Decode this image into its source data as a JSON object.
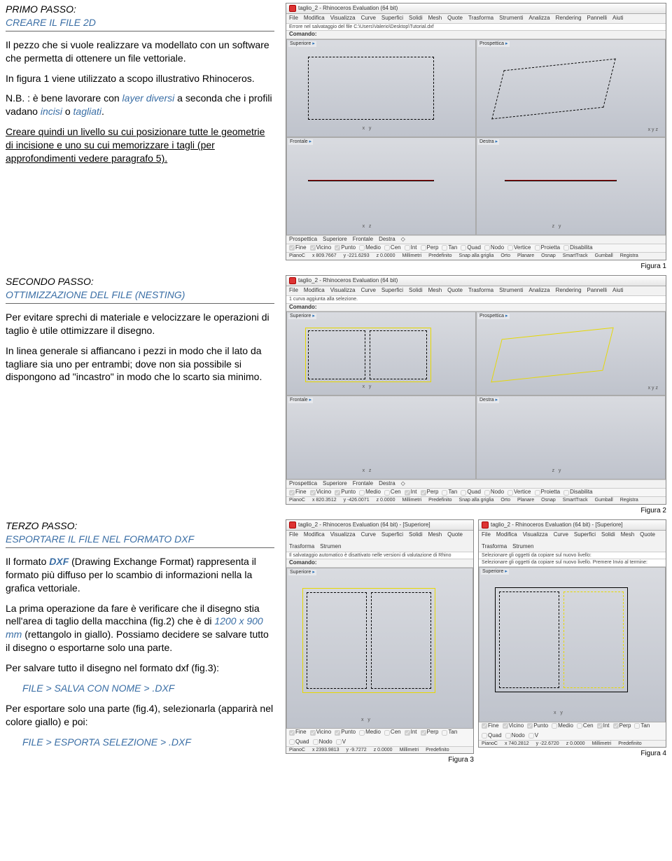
{
  "step1": {
    "label": "PRIMO PASSO:",
    "subtitle": "CREARE IL FILE 2D",
    "p1a": "Il pezzo che si vuole realizzare va modellato con un software che permetta di ottenere un file vettoriale.",
    "p1b": "In figura 1 viene utilizzato a scopo illustrativo Rhinoceros.",
    "p2a": "N.B. : è bene lavorare con ",
    "p2b": "layer diversi",
    "p2c": " a seconda che i profili vadano ",
    "p2d": "incisi",
    "p2e": " o ",
    "p2f": "tagliati",
    "p2g": ".",
    "p3": "Creare quindi un livello su cui posizionare tutte le geometrie di incisione e uno su cui memorizzare i tagli (per approfondimenti vedere paragrafo 5).",
    "figcap": "Figura 1"
  },
  "step2": {
    "label": "SECONDO PASSO:",
    "subtitle": "OTTIMIZZAZIONE DEL FILE (NESTING)",
    "p1": "Per evitare sprechi di materiale e velocizzare le operazioni di taglio è utile ottimizzare il disegno.",
    "p2": "In linea generale si affiancano i pezzi in modo che il lato da tagliare sia uno per entrambi; dove non sia possibile si dispongono ad \"incastro\" in modo che lo scarto sia minimo.",
    "figcap": "Figura 2"
  },
  "step3": {
    "label": "TERZO PASSO:",
    "subtitle": "ESPORTARE IL FILE NEL FORMATO DXF",
    "p1a": "Il formato ",
    "p1b": "DXF",
    "p1c": " (Drawing Exchange Format) rappresenta il formato più diffuso per lo scambio di informazioni nella la grafica vettoriale.",
    "p2a": "La prima operazione da fare è verificare che il disegno stia nell'area di taglio della macchina (fig.2) che è di ",
    "p2b": "1200 x 900 mm",
    "p2c": " (rettangolo in giallo). Possiamo decidere se salvare tutto il disegno o esportarne solo una parte.",
    "p3": "Per salvare tutto il disegno nel formato dxf (fig.3):",
    "menu1": "FILE > SALVA CON NOME > .DXF",
    "p4": "Per esportare solo una parte (fig.4), selezionarla (apparirà nel colore giallo) e poi:",
    "menu2": "FILE > ESPORTA SELEZIONE > .DXF",
    "figcap3": "Figura 3",
    "figcap4": "Figura 4"
  },
  "rhino": {
    "title1": "taglio_2 - Rhinoceros Evaluation (64 bit)",
    "title3": "taglio_2 - Rhinoceros Evaluation (64 bit) - [Superiore]",
    "menus": [
      "File",
      "Modifica",
      "Visualizza",
      "Curve",
      "Superfici",
      "Solidi",
      "Mesh",
      "Quote",
      "Trasforma",
      "Strumenti",
      "Analizza",
      "Rendering",
      "Pannelli",
      "Aiuti"
    ],
    "menus_short": [
      "File",
      "Modifica",
      "Visualizza",
      "Curve",
      "Superfici",
      "Solidi",
      "Mesh",
      "Quote",
      "Trasforma",
      "Strumen"
    ],
    "cmd1_1": "Errore nel salvataggio del file C:\\Users\\Valerio\\Desktop\\Tutorial.dxf",
    "cmd_label": "Comando:",
    "cmd2_1": "1 curva aggiunta alla selezione.",
    "cmd3_1": "Il salvataggio automatico è disattivato nelle versioni di valutazione di Rhino",
    "cmd4_1": "Selezionare gli oggetti da copiare sul nuovo livello:",
    "cmd4_2": "Selezionare gli oggetti da copiare sul nuovo livello. Premere Invio al termine:",
    "views": {
      "sup": "Superiore",
      "pro": "Prospettica",
      "fro": "Frontale",
      "des": "Destra"
    },
    "tabs": [
      "Prospettica",
      "Superiore",
      "Frontale",
      "Destra",
      "◇"
    ],
    "osnap": [
      "Fine",
      "Vicino",
      "Punto",
      "Medio",
      "Cen",
      "Int",
      "Perp",
      "Tan",
      "Quad",
      "Nodo",
      "Vertice",
      "Proietta",
      "Disabilita"
    ],
    "osnap_short": [
      "Fine",
      "Vicino",
      "Punto",
      "Medio",
      "Cen",
      "Int",
      "Perp",
      "Tan",
      "Quad",
      "Nodo",
      "V"
    ],
    "status1": {
      "plane": "PianoC",
      "x": "x 809.7667",
      "y": "y -221.6293",
      "z": "z 0.0000",
      "unit": "Millimetri",
      "def": "Predefinito",
      "rest": [
        "Snap alla griglia",
        "Orto",
        "Planare",
        "Osnap",
        "SmartTrack",
        "Gumball",
        "Registra"
      ]
    },
    "status2": {
      "plane": "PianoC",
      "x": "x 820.3512",
      "y": "y -426.0071",
      "z": "z 0.0000",
      "unit": "Millimetri",
      "def": "Predefinito",
      "rest": [
        "Snap alla griglia",
        "Orto",
        "Planare",
        "Osnap",
        "SmartTrack",
        "Gumball",
        "Registra"
      ]
    },
    "status3": {
      "plane": "PianoC",
      "x": "x 2393.9813",
      "y": "y -9.7272",
      "z": "z 0.0000",
      "unit": "Millimetri",
      "def": "Predefinito"
    },
    "status4": {
      "plane": "PianoC",
      "x": "x 740.2812",
      "y": "y -22.6720",
      "z": "z 0.0000",
      "unit": "Millimetri",
      "def": "Predefinito"
    },
    "tri": "▸"
  }
}
